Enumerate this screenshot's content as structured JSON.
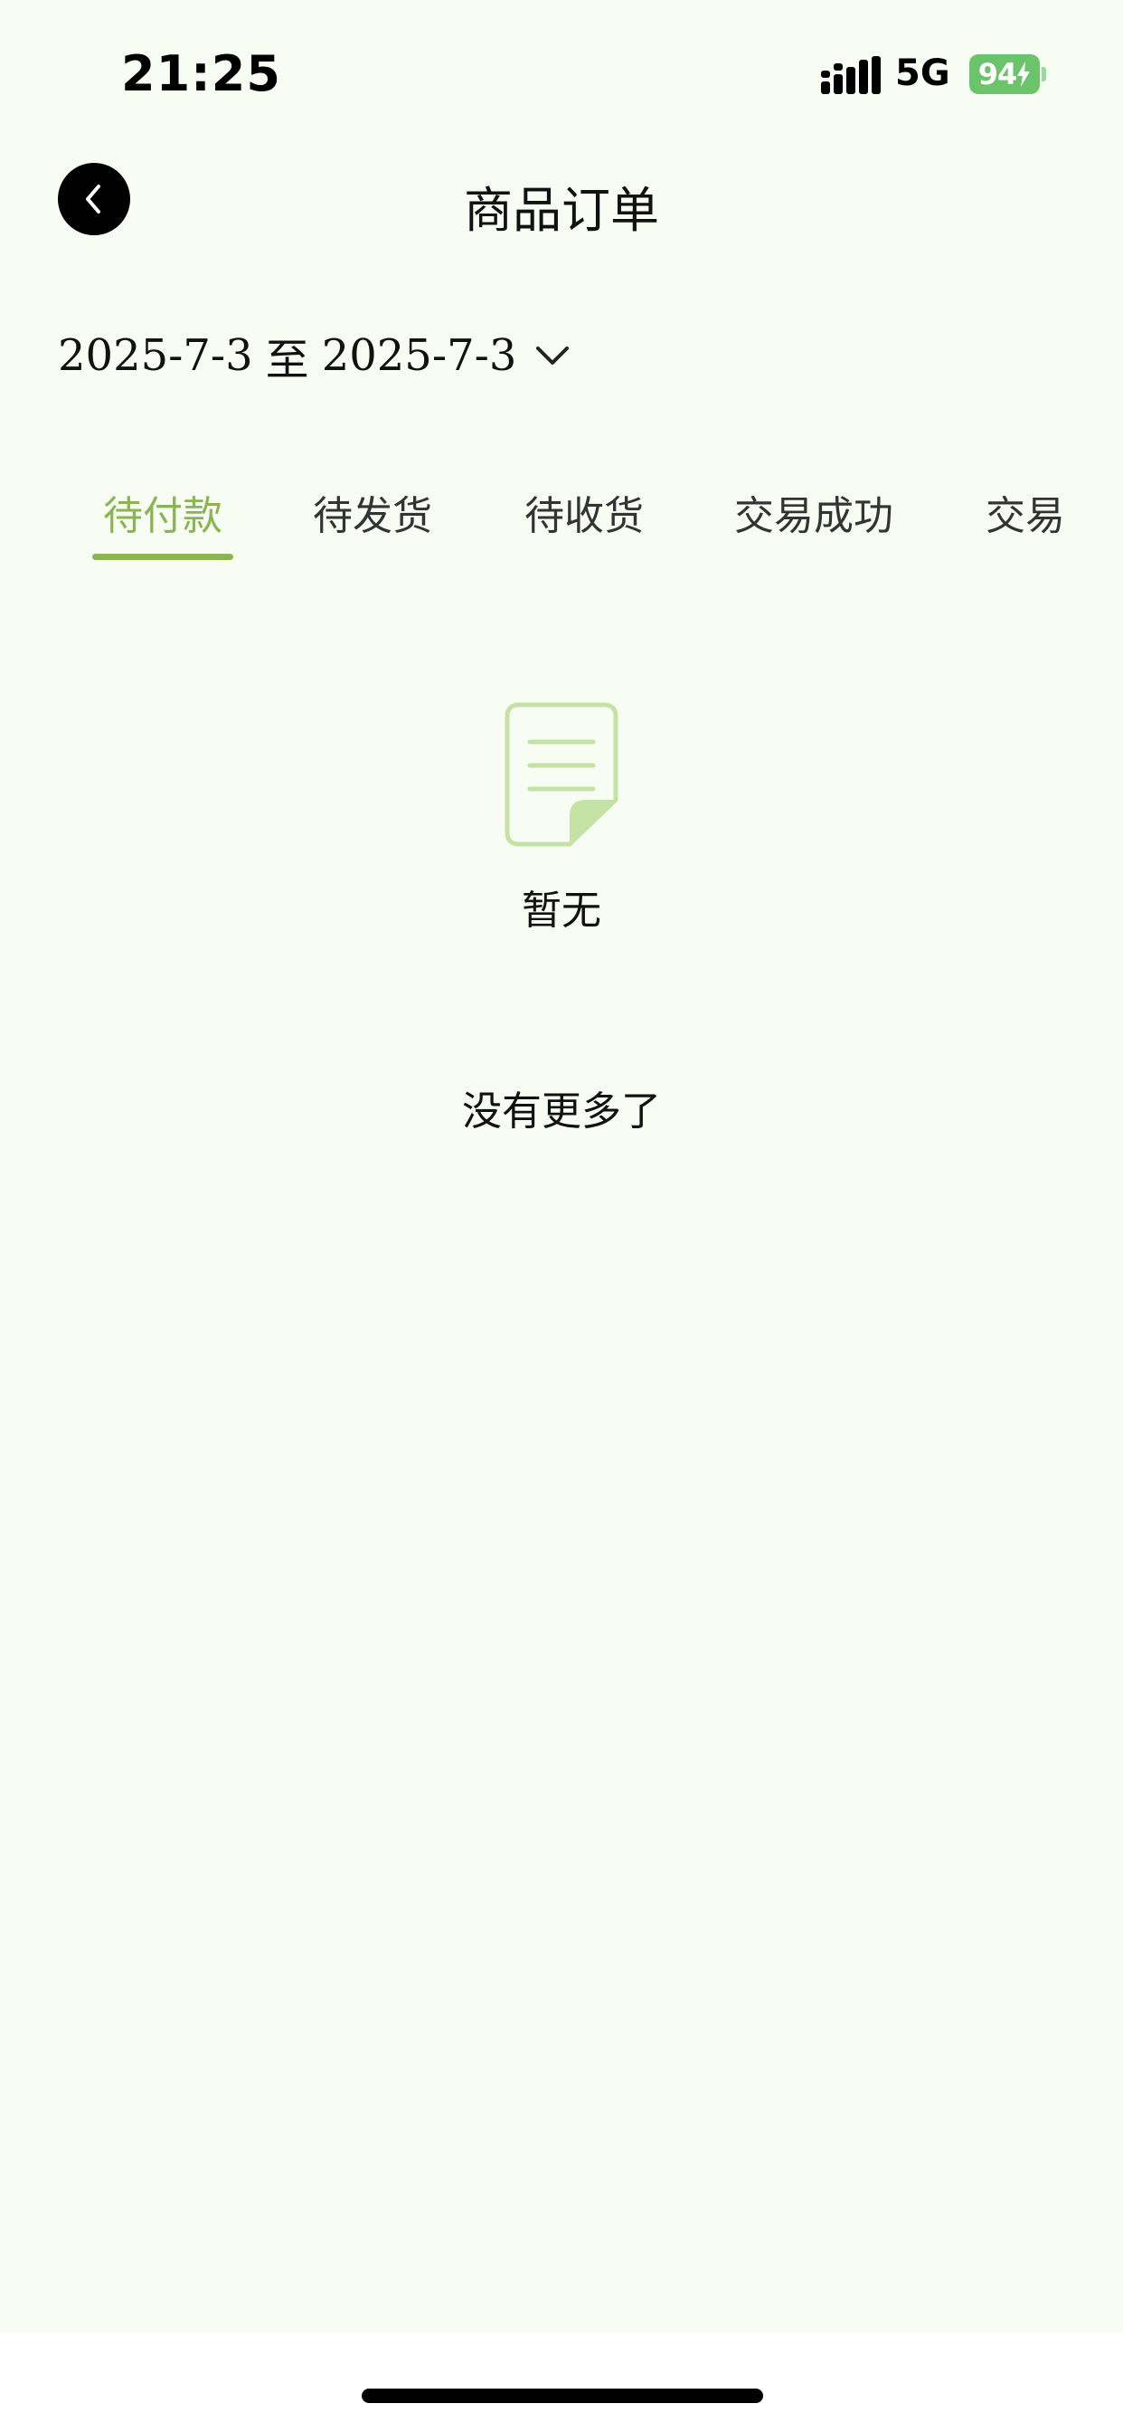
{
  "status_bar": {
    "time": "21:25",
    "network": "5G",
    "battery_level": "94",
    "battery_color": "#6cc46a",
    "signal_icon": "signal-bars-icon",
    "charging_icon": "lightning-icon"
  },
  "header": {
    "title": "商品订单",
    "back_icon": "chevron-left-icon"
  },
  "filter": {
    "date_start": "2025-7-3",
    "date_separator": "至",
    "date_end": "2025-7-3",
    "dropdown_icon": "chevron-down-icon"
  },
  "tabs": {
    "active_index": 0,
    "accent_color": "#8ab553",
    "items": [
      {
        "label": "待付款"
      },
      {
        "label": "待发货"
      },
      {
        "label": "待收货"
      },
      {
        "label": "交易成功"
      },
      {
        "label": "交易"
      }
    ]
  },
  "empty_state": {
    "icon": "document-icon",
    "text": "暂无"
  },
  "list_footer": {
    "text": "没有更多了"
  }
}
